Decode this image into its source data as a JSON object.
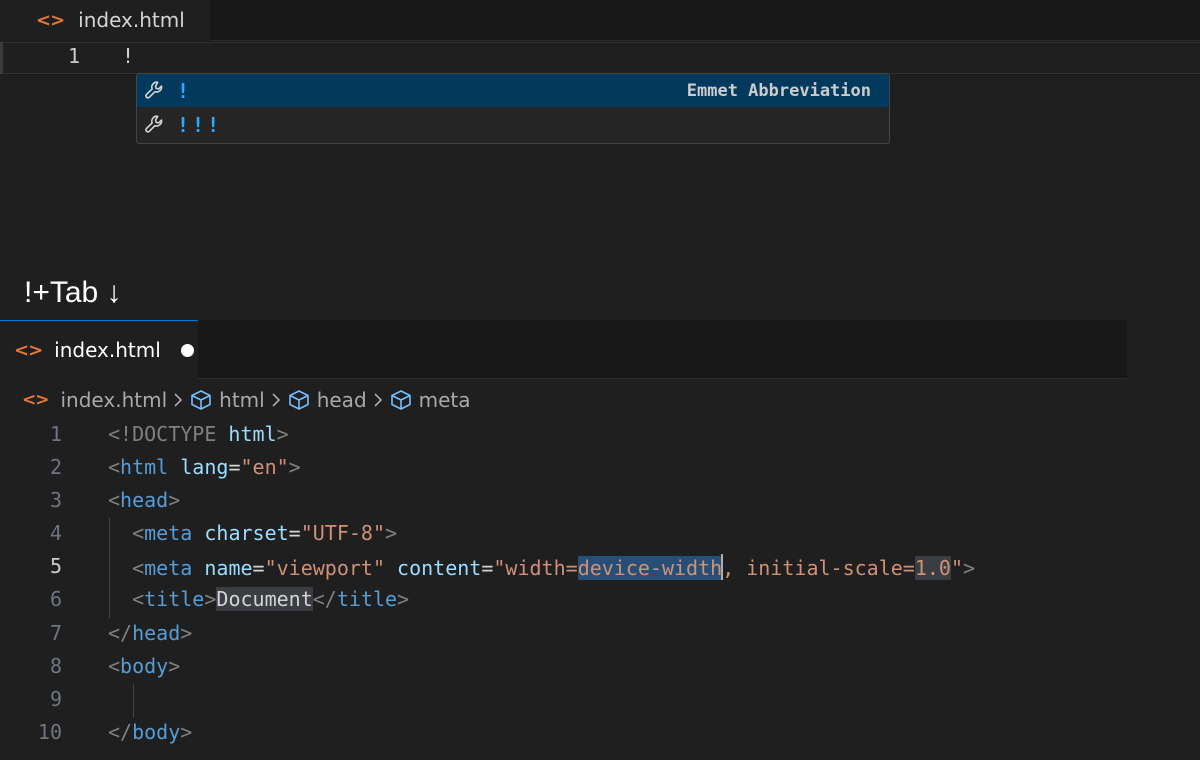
{
  "top_editor": {
    "tab": {
      "icon": "html-file-icon",
      "label": "index.html"
    },
    "line_number": "1",
    "line_text": "!",
    "suggestions": [
      {
        "icon": "wrench-icon",
        "label": "!",
        "detail": "Emmet Abbreviation",
        "selected": true
      },
      {
        "icon": "wrench-icon",
        "label": "!!!",
        "detail": "",
        "selected": false
      }
    ]
  },
  "caption": "!+Tab ↓",
  "bottom_editor": {
    "tab": {
      "icon": "html-file-icon",
      "label": "index.html",
      "modified": true
    },
    "breadcrumb": [
      {
        "icon": "html-file-icon",
        "label": "index.html"
      },
      {
        "icon": "symbol-cube-icon",
        "label": "html"
      },
      {
        "icon": "symbol-cube-icon",
        "label": "head"
      },
      {
        "icon": "symbol-cube-icon",
        "label": "meta"
      }
    ],
    "active_line": "5",
    "line_numbers": [
      "1",
      "2",
      "3",
      "4",
      "5",
      "6",
      "7",
      "8",
      "9",
      "10"
    ],
    "tokens": {
      "l1_doctype": "<!DOCTYPE",
      "l1_html": "html",
      "l1_close": ">",
      "lt": "<",
      "gt": ">",
      "lts": "</",
      "eq": "=",
      "l2_tag": "html",
      "l2_attr": "lang",
      "l2_val": "\"en\"",
      "head": "head",
      "meta": "meta",
      "l4_attr": "charset",
      "l4_val": "\"UTF-8\"",
      "l5_attr1": "name",
      "l5_val1": "\"viewport\"",
      "l5_attr2": "content",
      "l5_val2a": "\"width=",
      "l5_val2b": "device-width",
      "l5_val2c": ", initial-scale=",
      "l5_val2d": "1.0",
      "l5_val2e": "\"",
      "title": "title",
      "l6_text": "Document",
      "body": "body"
    }
  }
}
